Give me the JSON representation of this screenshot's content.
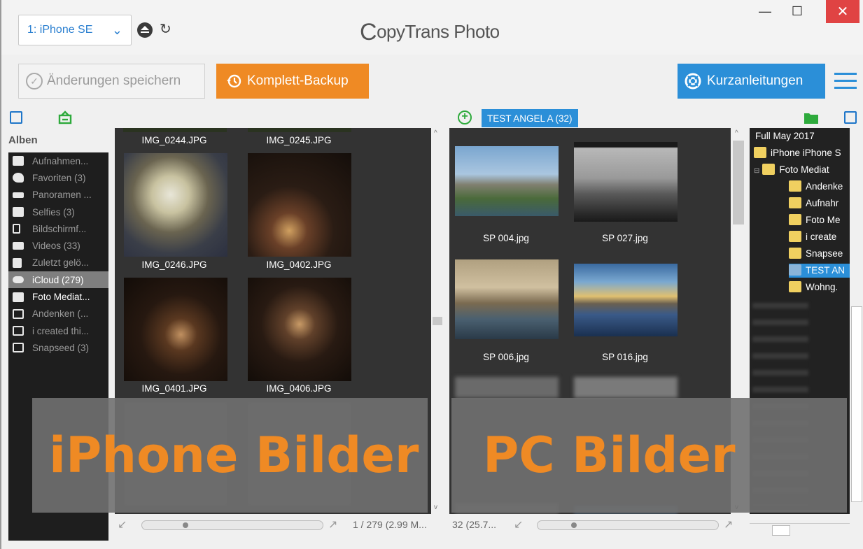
{
  "titlebar": {
    "device_select": "1: iPhone SE",
    "app_title_c": "C",
    "app_title_rest": "opyTrans Photo",
    "minimize": "—",
    "maximize": "☐",
    "close": "✕"
  },
  "toolbar": {
    "save_label": "Änderungen speichern",
    "backup_label": "Komplett-Backup",
    "guide_label": "Kurzanleitungen"
  },
  "left": {
    "albums_header": "Alben",
    "albums": [
      {
        "label": "Aufnahmen...",
        "icon": "camera-roll-icon"
      },
      {
        "label": "Favoriten (3)",
        "icon": "heart-icon"
      },
      {
        "label": "Panoramen ...",
        "icon": "panorama-icon"
      },
      {
        "label": "Selfies (3)",
        "icon": "selfie-icon"
      },
      {
        "label": "Bildschirmf...",
        "icon": "phone-icon"
      },
      {
        "label": "Videos (33)",
        "icon": "video-icon"
      },
      {
        "label": "Zuletzt gelö...",
        "icon": "trash-icon"
      },
      {
        "label": "iCloud (279)",
        "icon": "cloud-icon"
      },
      {
        "label": "Foto Mediat...",
        "icon": "photo-icon"
      },
      {
        "label": "Andenken (...",
        "icon": "album-icon"
      },
      {
        "label": "i created thi...",
        "icon": "album-icon"
      },
      {
        "label": "Snapseed (3)",
        "icon": "album-icon"
      }
    ],
    "photos": [
      "IMG_0244.JPG",
      "IMG_0245.JPG",
      "IMG_0246.JPG",
      "IMG_0402.JPG",
      "IMG_0401.JPG",
      "IMG_0406.JPG"
    ],
    "status": "1 / 279 (2.99 M..."
  },
  "right": {
    "album_tag": "TEST ANGEL A (32)",
    "photos": [
      "SP 004.jpg",
      "SP 027.jpg",
      "SP 006.jpg",
      "SP 016.jpg"
    ],
    "status": "32 (25.7...",
    "tree": [
      "Full May 2017",
      "iPhone iPhone S",
      "Foto Mediat",
      "Andenke",
      "Aufnahr",
      "Foto Me",
      "i create",
      "Snapsee",
      "TEST AN",
      "Wohng."
    ]
  },
  "overlays": {
    "left": "iPhone Bilder",
    "right": "PC Bilder"
  },
  "colors": {
    "accent_orange": "#ef8a24",
    "accent_blue": "#2b8fd8",
    "close_red": "#e04343"
  }
}
